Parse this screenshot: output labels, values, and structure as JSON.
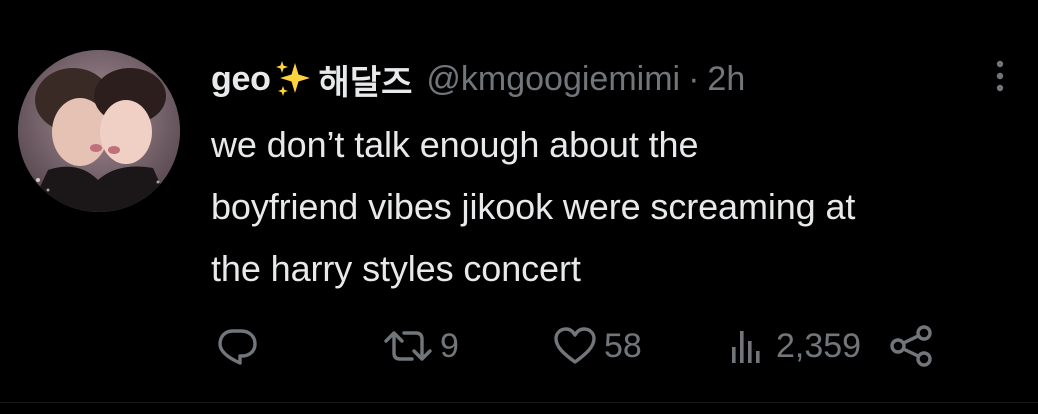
{
  "tweet": {
    "display_name": "geo",
    "display_name_suffix": "해달즈",
    "handle": "@kmgoogiemimi",
    "separator": "·",
    "timestamp": "2h",
    "text_lines": [
      "we don’t talk enough about the",
      "boyfriend vibes jikook were screaming at",
      "the harry styles concert"
    ],
    "actions": {
      "reply_count": "",
      "retweet_count": "9",
      "like_count": "58",
      "views_count": "2,359"
    }
  },
  "icons": {
    "sparkle": "sparkles-emoji-icon",
    "more": "more-options-icon",
    "reply": "reply-icon",
    "retweet": "retweet-icon",
    "like": "heart-icon",
    "views": "views-bar-chart-icon",
    "share": "share-icon"
  },
  "colors": {
    "background": "#000000",
    "primary_text": "#e7e9ea",
    "secondary_text": "#71767b",
    "sparkle": "#ffd23f"
  }
}
